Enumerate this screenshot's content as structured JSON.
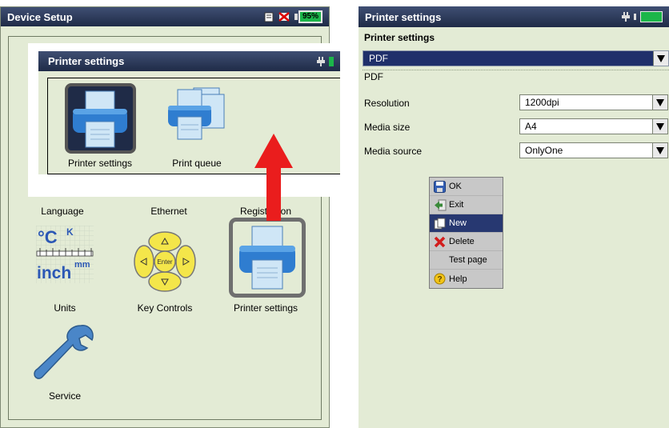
{
  "left_screen": {
    "title": "Device Setup",
    "battery": "95%",
    "icons": [
      {
        "label": "Language"
      },
      {
        "label": "Ethernet"
      },
      {
        "label": "Registration"
      },
      {
        "label": "Units"
      },
      {
        "label": "Key Controls"
      },
      {
        "label": "Printer settings"
      },
      {
        "label": "Service"
      }
    ],
    "units_icon_text": {
      "top": "°C",
      "k": "K",
      "bottom": "inch",
      "mm": "mm"
    },
    "key_controls_center": "Enter"
  },
  "inset": {
    "title": "Printer settings",
    "icons": [
      {
        "label": "Printer settings"
      },
      {
        "label": "Print queue"
      }
    ]
  },
  "right_screen": {
    "title": "Printer settings",
    "header": "Printer settings",
    "selected_printer": "PDF",
    "printer_name": "PDF",
    "rows": [
      {
        "label": "Resolution",
        "value": "1200dpi"
      },
      {
        "label": "Media size",
        "value": "A4"
      },
      {
        "label": "Media source",
        "value": "OnlyOne"
      }
    ],
    "menu": [
      {
        "label": "OK",
        "icon": "save-icon"
      },
      {
        "label": "Exit",
        "icon": "exit-arrow-icon"
      },
      {
        "label": "New",
        "icon": "new-document-icon"
      },
      {
        "label": "Delete",
        "icon": "delete-x-icon"
      },
      {
        "label": "Test page",
        "icon": ""
      },
      {
        "label": "Help",
        "icon": "help-icon"
      }
    ]
  },
  "colors": {
    "screen_bg": "#e3ebd5",
    "titlebar": "#1f2b47",
    "selection": "#273871",
    "battery": "#1cb64a",
    "arrow": "#ea1d1d",
    "highlight_frame": "#6f6f6f"
  }
}
